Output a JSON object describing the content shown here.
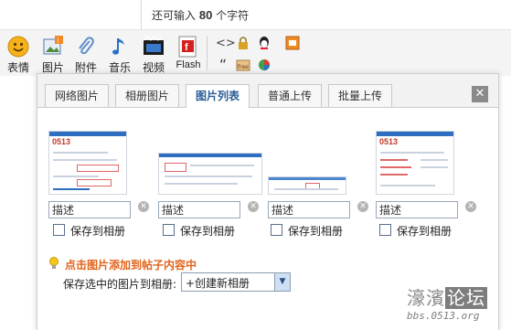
{
  "header": {
    "char_hint_prefix": "还可输入",
    "char_hint_count": "80",
    "char_hint_suffix": "个字符"
  },
  "toolbar": {
    "buttons": [
      {
        "label": "表情",
        "icon": "smiley-icon"
      },
      {
        "label": "图片",
        "icon": "image-icon"
      },
      {
        "label": "附件",
        "icon": "paperclip-icon"
      },
      {
        "label": "音乐",
        "icon": "music-note-icon"
      },
      {
        "label": "视频",
        "icon": "film-icon"
      },
      {
        "label": "Flash",
        "icon": "flash-icon"
      }
    ],
    "mini_icons": [
      "code-icon",
      "lock-icon",
      "qq-icon",
      "quote-icon",
      "free-icon",
      "chart-icon",
      "box-icon"
    ]
  },
  "dialog": {
    "tabs": [
      {
        "label": "网络图片",
        "active": false
      },
      {
        "label": "相册图片",
        "active": false
      },
      {
        "label": "图片列表",
        "active": true
      },
      {
        "label": "普通上传",
        "active": false
      },
      {
        "label": "批量上传",
        "active": false
      }
    ],
    "close_label": "✕",
    "thumb_logo": "0513",
    "items": [
      {
        "description": "描述",
        "save_label": "保存到相册"
      },
      {
        "description": "描述",
        "save_label": "保存到相册"
      },
      {
        "description": "描述",
        "save_label": "保存到相册"
      },
      {
        "description": "描述",
        "save_label": "保存到相册"
      }
    ],
    "hint": "点击图片添加到帖子内容中",
    "save_selected_label": "保存选中的图片到相册:",
    "album_select": {
      "value": "+创建新相册"
    }
  },
  "watermark": {
    "main_a": "濠濱",
    "main_b": "论坛",
    "url": "bbs.0513.org"
  },
  "colors": {
    "accent": "#2b5d95",
    "hint": "#e1631b",
    "close_bg": "#8a8a8a"
  }
}
